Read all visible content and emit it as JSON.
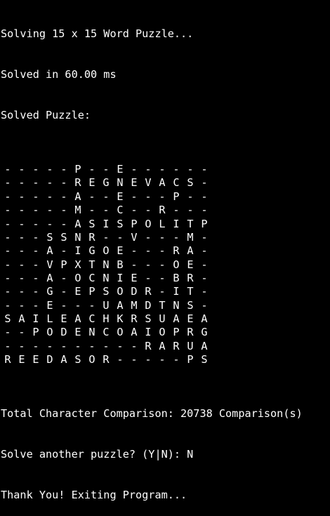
{
  "terminal": {
    "header": [
      "Solving 15 x 15 Word Puzzle...",
      "Solved in 60.00 ms",
      "Solved Puzzle:"
    ],
    "grid": [
      [
        "-",
        "-",
        "-",
        "-",
        "-",
        "P",
        "-",
        "-",
        "E",
        "-",
        "-",
        "-",
        "-",
        "-",
        "-"
      ],
      [
        "-",
        "-",
        "-",
        "-",
        "-",
        "R",
        "E",
        "G",
        "N",
        "E",
        "V",
        "A",
        "C",
        "S",
        "-"
      ],
      [
        "-",
        "-",
        "-",
        "-",
        "-",
        "A",
        "-",
        "-",
        "E",
        "-",
        "-",
        "-",
        "P",
        "-",
        "-"
      ],
      [
        "-",
        "-",
        "-",
        "-",
        "-",
        "M",
        "-",
        "-",
        "C",
        "-",
        "-",
        "R",
        "-",
        "-",
        "-"
      ],
      [
        "-",
        "-",
        "-",
        "-",
        "-",
        "A",
        "S",
        "I",
        "S",
        "P",
        "O",
        "L",
        "I",
        "T",
        "P"
      ],
      [
        "-",
        "-",
        "-",
        "S",
        "S",
        "N",
        "R",
        "-",
        "-",
        "V",
        "-",
        "-",
        "-",
        "M",
        "-"
      ],
      [
        "-",
        "-",
        "-",
        "A",
        "-",
        "I",
        "G",
        "O",
        "E",
        "-",
        "-",
        "-",
        "R",
        "A",
        "-"
      ],
      [
        "-",
        "-",
        "-",
        "V",
        "P",
        "X",
        "T",
        "N",
        "B",
        "-",
        "-",
        "-",
        "O",
        "E",
        "-"
      ],
      [
        "-",
        "-",
        "-",
        "A",
        "-",
        "O",
        "C",
        "N",
        "I",
        "E",
        "-",
        "-",
        "B",
        "R",
        "-"
      ],
      [
        "-",
        "-",
        "-",
        "G",
        "-",
        "E",
        "P",
        "S",
        "O",
        "D",
        "R",
        "-",
        "I",
        "T",
        "-"
      ],
      [
        "-",
        "-",
        "-",
        "E",
        "-",
        "-",
        "-",
        "U",
        "A",
        "M",
        "D",
        "T",
        "N",
        "S",
        "-"
      ],
      [
        "S",
        "A",
        "I",
        "L",
        "E",
        "A",
        "C",
        "H",
        "K",
        "R",
        "S",
        "U",
        "A",
        "E",
        "A"
      ],
      [
        "-",
        "-",
        "P",
        "O",
        "D",
        "E",
        "N",
        "C",
        "O",
        "A",
        "I",
        "O",
        "P",
        "R",
        "G"
      ],
      [
        "-",
        "-",
        "-",
        "-",
        "-",
        "-",
        "-",
        "-",
        "-",
        "-",
        "R",
        "A",
        "R",
        "U",
        "A"
      ],
      [
        "R",
        "E",
        "E",
        "D",
        "A",
        "S",
        "O",
        "R",
        "-",
        "-",
        "-",
        "-",
        "-",
        "P",
        "S"
      ]
    ],
    "footer": [
      "Total Character Comparison: 20738 Comparison(s)",
      "Solve another puzzle? (Y|N): N",
      "Thank You! Exiting Program..."
    ]
  }
}
